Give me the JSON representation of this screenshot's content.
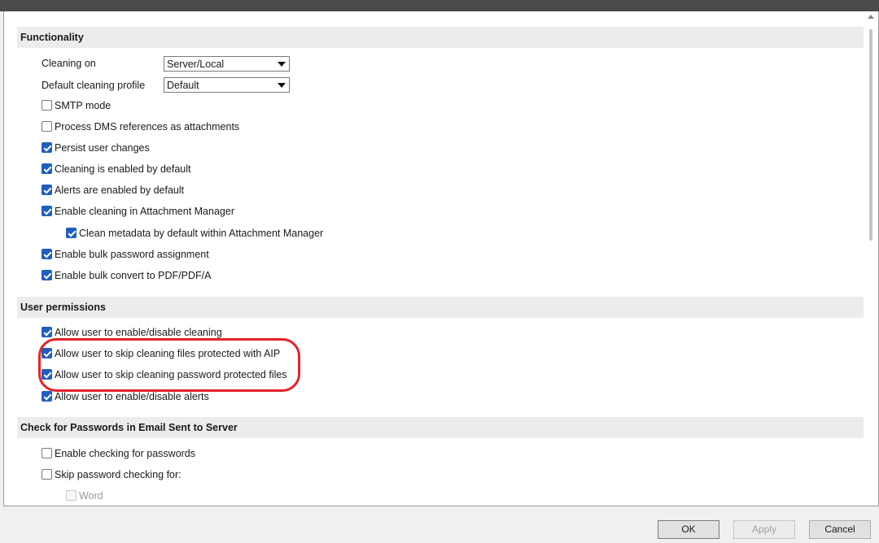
{
  "functionality": {
    "title": "Functionality",
    "cleaning_on_label": "Cleaning on",
    "cleaning_on_value": "Server/Local",
    "default_profile_label": "Default cleaning profile",
    "default_profile_value": "Default",
    "options": [
      {
        "label": "SMTP mode",
        "checked": false
      },
      {
        "label": "Process DMS references as attachments",
        "checked": false
      },
      {
        "label": "Persist user changes",
        "checked": true
      },
      {
        "label": "Cleaning is enabled by default",
        "checked": true
      },
      {
        "label": "Alerts are enabled by default",
        "checked": true
      },
      {
        "label": "Enable cleaning in Attachment Manager",
        "checked": true
      },
      {
        "label": "Clean metadata by default within Attachment Manager",
        "checked": true
      },
      {
        "label": "Enable bulk password assignment",
        "checked": true
      },
      {
        "label": "Enable bulk convert to PDF/PDF/A",
        "checked": true
      }
    ]
  },
  "user_permissions": {
    "title": "User permissions",
    "options": [
      {
        "label": "Allow user to enable/disable cleaning",
        "checked": true
      },
      {
        "label": "Allow user to skip cleaning files protected with AIP",
        "checked": true
      },
      {
        "label": "Allow user to skip cleaning password protected files",
        "checked": true
      },
      {
        "label": "Allow user to enable/disable alerts",
        "checked": true
      }
    ]
  },
  "password_check": {
    "title": "Check for Passwords in Email Sent to Server",
    "options": [
      {
        "label": "Enable checking for passwords",
        "checked": false
      },
      {
        "label": "Skip password checking for:",
        "checked": false
      },
      {
        "label": "Word",
        "checked": false,
        "disabled": true
      }
    ]
  },
  "footer": {
    "ok_label": "OK",
    "apply_label": "Apply",
    "cancel_label": "Cancel"
  },
  "colors": {
    "accent": "#1f5fbf",
    "highlight": "#e3222c"
  }
}
